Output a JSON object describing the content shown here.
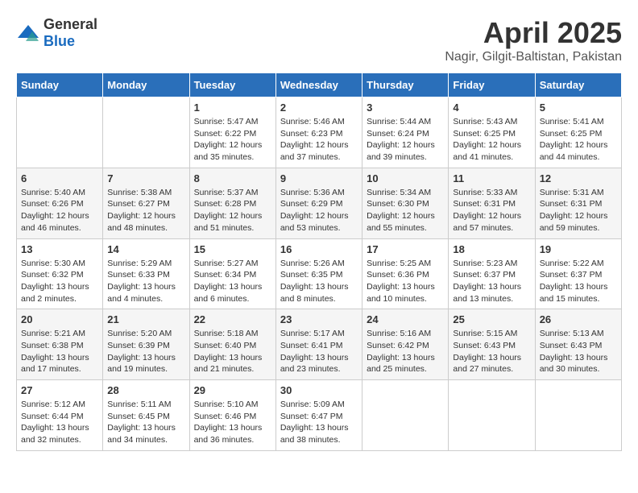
{
  "header": {
    "logo": {
      "general": "General",
      "blue": "Blue"
    },
    "month": "April 2025",
    "location": "Nagir, Gilgit-Baltistan, Pakistan"
  },
  "days_of_week": [
    "Sunday",
    "Monday",
    "Tuesday",
    "Wednesday",
    "Thursday",
    "Friday",
    "Saturday"
  ],
  "weeks": [
    [
      {
        "day": "",
        "info": ""
      },
      {
        "day": "",
        "info": ""
      },
      {
        "day": "1",
        "sunrise": "Sunrise: 5:47 AM",
        "sunset": "Sunset: 6:22 PM",
        "daylight": "Daylight: 12 hours and 35 minutes."
      },
      {
        "day": "2",
        "sunrise": "Sunrise: 5:46 AM",
        "sunset": "Sunset: 6:23 PM",
        "daylight": "Daylight: 12 hours and 37 minutes."
      },
      {
        "day": "3",
        "sunrise": "Sunrise: 5:44 AM",
        "sunset": "Sunset: 6:24 PM",
        "daylight": "Daylight: 12 hours and 39 minutes."
      },
      {
        "day": "4",
        "sunrise": "Sunrise: 5:43 AM",
        "sunset": "Sunset: 6:25 PM",
        "daylight": "Daylight: 12 hours and 41 minutes."
      },
      {
        "day": "5",
        "sunrise": "Sunrise: 5:41 AM",
        "sunset": "Sunset: 6:25 PM",
        "daylight": "Daylight: 12 hours and 44 minutes."
      }
    ],
    [
      {
        "day": "6",
        "sunrise": "Sunrise: 5:40 AM",
        "sunset": "Sunset: 6:26 PM",
        "daylight": "Daylight: 12 hours and 46 minutes."
      },
      {
        "day": "7",
        "sunrise": "Sunrise: 5:38 AM",
        "sunset": "Sunset: 6:27 PM",
        "daylight": "Daylight: 12 hours and 48 minutes."
      },
      {
        "day": "8",
        "sunrise": "Sunrise: 5:37 AM",
        "sunset": "Sunset: 6:28 PM",
        "daylight": "Daylight: 12 hours and 51 minutes."
      },
      {
        "day": "9",
        "sunrise": "Sunrise: 5:36 AM",
        "sunset": "Sunset: 6:29 PM",
        "daylight": "Daylight: 12 hours and 53 minutes."
      },
      {
        "day": "10",
        "sunrise": "Sunrise: 5:34 AM",
        "sunset": "Sunset: 6:30 PM",
        "daylight": "Daylight: 12 hours and 55 minutes."
      },
      {
        "day": "11",
        "sunrise": "Sunrise: 5:33 AM",
        "sunset": "Sunset: 6:31 PM",
        "daylight": "Daylight: 12 hours and 57 minutes."
      },
      {
        "day": "12",
        "sunrise": "Sunrise: 5:31 AM",
        "sunset": "Sunset: 6:31 PM",
        "daylight": "Daylight: 12 hours and 59 minutes."
      }
    ],
    [
      {
        "day": "13",
        "sunrise": "Sunrise: 5:30 AM",
        "sunset": "Sunset: 6:32 PM",
        "daylight": "Daylight: 13 hours and 2 minutes."
      },
      {
        "day": "14",
        "sunrise": "Sunrise: 5:29 AM",
        "sunset": "Sunset: 6:33 PM",
        "daylight": "Daylight: 13 hours and 4 minutes."
      },
      {
        "day": "15",
        "sunrise": "Sunrise: 5:27 AM",
        "sunset": "Sunset: 6:34 PM",
        "daylight": "Daylight: 13 hours and 6 minutes."
      },
      {
        "day": "16",
        "sunrise": "Sunrise: 5:26 AM",
        "sunset": "Sunset: 6:35 PM",
        "daylight": "Daylight: 13 hours and 8 minutes."
      },
      {
        "day": "17",
        "sunrise": "Sunrise: 5:25 AM",
        "sunset": "Sunset: 6:36 PM",
        "daylight": "Daylight: 13 hours and 10 minutes."
      },
      {
        "day": "18",
        "sunrise": "Sunrise: 5:23 AM",
        "sunset": "Sunset: 6:37 PM",
        "daylight": "Daylight: 13 hours and 13 minutes."
      },
      {
        "day": "19",
        "sunrise": "Sunrise: 5:22 AM",
        "sunset": "Sunset: 6:37 PM",
        "daylight": "Daylight: 13 hours and 15 minutes."
      }
    ],
    [
      {
        "day": "20",
        "sunrise": "Sunrise: 5:21 AM",
        "sunset": "Sunset: 6:38 PM",
        "daylight": "Daylight: 13 hours and 17 minutes."
      },
      {
        "day": "21",
        "sunrise": "Sunrise: 5:20 AM",
        "sunset": "Sunset: 6:39 PM",
        "daylight": "Daylight: 13 hours and 19 minutes."
      },
      {
        "day": "22",
        "sunrise": "Sunrise: 5:18 AM",
        "sunset": "Sunset: 6:40 PM",
        "daylight": "Daylight: 13 hours and 21 minutes."
      },
      {
        "day": "23",
        "sunrise": "Sunrise: 5:17 AM",
        "sunset": "Sunset: 6:41 PM",
        "daylight": "Daylight: 13 hours and 23 minutes."
      },
      {
        "day": "24",
        "sunrise": "Sunrise: 5:16 AM",
        "sunset": "Sunset: 6:42 PM",
        "daylight": "Daylight: 13 hours and 25 minutes."
      },
      {
        "day": "25",
        "sunrise": "Sunrise: 5:15 AM",
        "sunset": "Sunset: 6:43 PM",
        "daylight": "Daylight: 13 hours and 27 minutes."
      },
      {
        "day": "26",
        "sunrise": "Sunrise: 5:13 AM",
        "sunset": "Sunset: 6:43 PM",
        "daylight": "Daylight: 13 hours and 30 minutes."
      }
    ],
    [
      {
        "day": "27",
        "sunrise": "Sunrise: 5:12 AM",
        "sunset": "Sunset: 6:44 PM",
        "daylight": "Daylight: 13 hours and 32 minutes."
      },
      {
        "day": "28",
        "sunrise": "Sunrise: 5:11 AM",
        "sunset": "Sunset: 6:45 PM",
        "daylight": "Daylight: 13 hours and 34 minutes."
      },
      {
        "day": "29",
        "sunrise": "Sunrise: 5:10 AM",
        "sunset": "Sunset: 6:46 PM",
        "daylight": "Daylight: 13 hours and 36 minutes."
      },
      {
        "day": "30",
        "sunrise": "Sunrise: 5:09 AM",
        "sunset": "Sunset: 6:47 PM",
        "daylight": "Daylight: 13 hours and 38 minutes."
      },
      {
        "day": "",
        "info": ""
      },
      {
        "day": "",
        "info": ""
      },
      {
        "day": "",
        "info": ""
      }
    ]
  ]
}
